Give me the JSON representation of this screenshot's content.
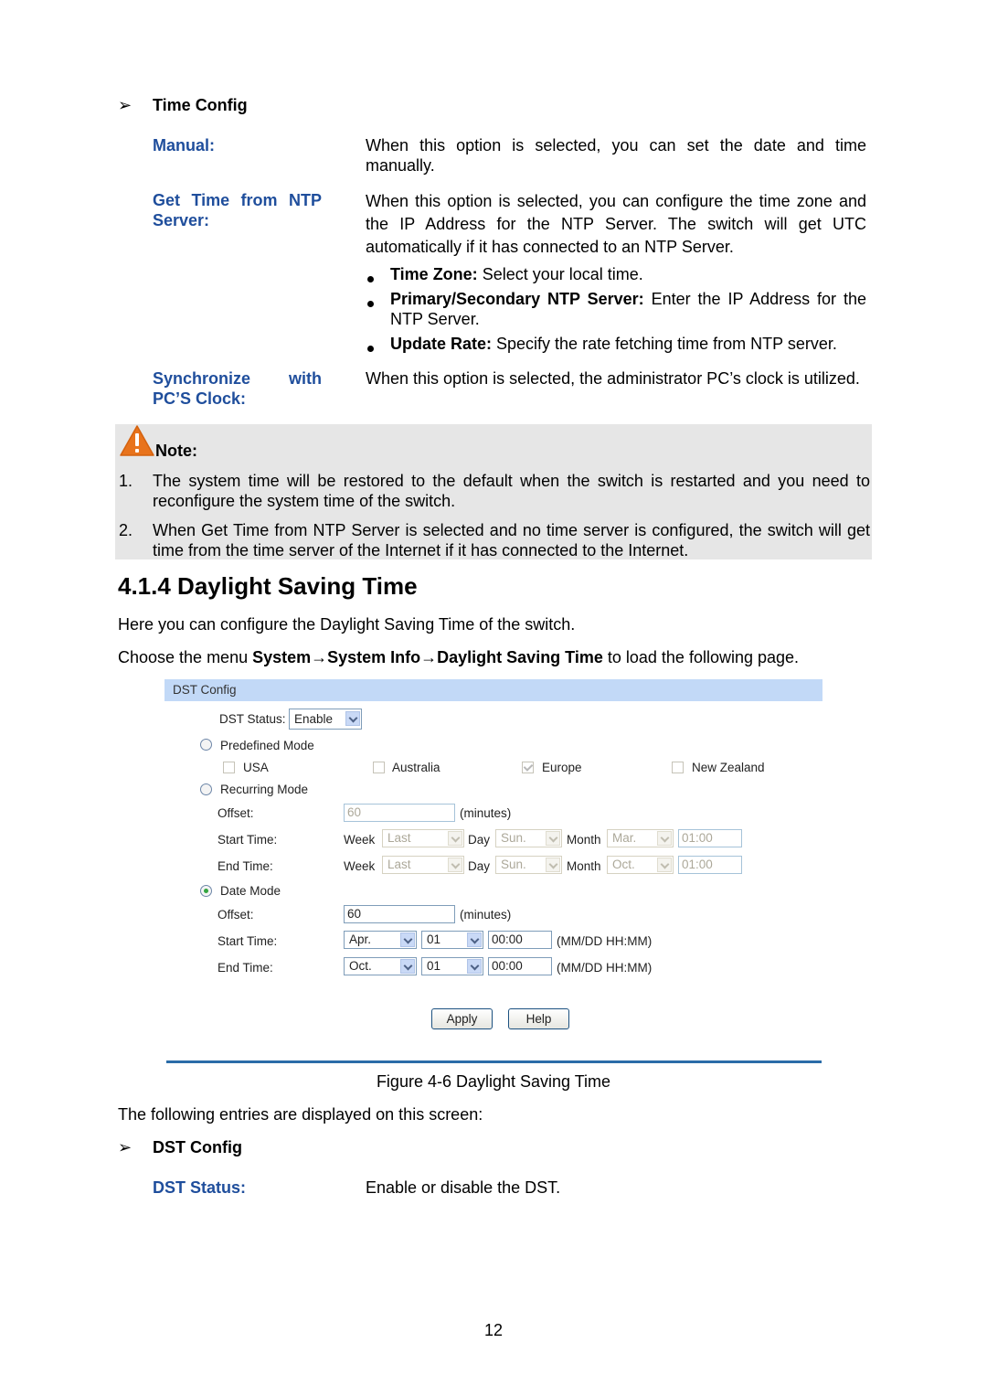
{
  "time_config": {
    "heading": "Time Config",
    "entries": [
      {
        "term": "Manual:",
        "desc": "When this option is selected, you can set the date and time manually."
      },
      {
        "term_line1": "Get Time from NTP",
        "term_line2": "Server:",
        "desc": "When this option is selected, you can configure the time zone and the IP Address for the NTP Server. The switch will get UTC automatically if it has connected to an NTP Server."
      },
      {
        "term_line1": "Synchronize with",
        "term_line2": "PC’S Clock:",
        "desc": "When this option is selected, the administrator PC’s clock is utilized."
      }
    ],
    "bullets": [
      {
        "bold": "Time Zone:",
        "text": " Select your local time."
      },
      {
        "bold": "Primary/Secondary NTP Server:",
        "text": " Enter the IP Address for the NTP Server."
      },
      {
        "bold": "Update Rate:",
        "text": " Specify the rate fetching time from NTP server."
      }
    ]
  },
  "note": {
    "label": "Note:",
    "items": [
      {
        "num": "1.",
        "text": "The system time will be restored to the default when the switch is restarted and you need to reconfigure the system time of the switch."
      },
      {
        "num": "2.",
        "text": "When Get Time from NTP Server is selected and no time server is configured, the switch will get time from the time server of the Internet if it has connected to the Internet."
      }
    ]
  },
  "section": {
    "title": "4.1.4 Daylight Saving Time",
    "intro": "Here you can configure the Daylight Saving Time of the switch.",
    "menu_prefix": "Choose the menu ",
    "menu_path": "System→System Info→Daylight Saving Time",
    "menu_suffix": " to load the following page."
  },
  "dst_ui": {
    "header": "DST Config",
    "status_label": "DST Status:",
    "status_value": "Enable",
    "predefined": {
      "label": "Predefined Mode",
      "selected": false,
      "options": [
        {
          "label": "USA",
          "checked": false
        },
        {
          "label": "Australia",
          "checked": false
        },
        {
          "label": "Europe",
          "checked": true
        },
        {
          "label": "New Zealand",
          "checked": false
        }
      ]
    },
    "recurring": {
      "label": "Recurring Mode",
      "selected": false,
      "offset_label": "Offset:",
      "offset_value": "60",
      "offset_unit": "(minutes)",
      "start_label": "Start Time:",
      "end_label": "End Time:",
      "week_label": "Week",
      "day_label": "Day",
      "month_label": "Month",
      "start": {
        "week": "Last",
        "day": "Sun.",
        "month": "Mar.",
        "time": "01:00"
      },
      "end": {
        "week": "Last",
        "day": "Sun.",
        "month": "Oct.",
        "time": "01:00"
      }
    },
    "date_mode": {
      "label": "Date Mode",
      "selected": true,
      "offset_label": "Offset:",
      "offset_value": "60",
      "offset_unit": "(minutes)",
      "start_label": "Start Time:",
      "end_label": "End Time:",
      "format_hint": "(MM/DD HH:MM)",
      "start": {
        "month": "Apr.",
        "day": "01",
        "time": "00:00"
      },
      "end": {
        "month": "Oct.",
        "day": "01",
        "time": "00:00"
      }
    },
    "apply_label": "Apply",
    "help_label": "Help"
  },
  "figure_caption": "Figure 4-6 Daylight Saving Time",
  "entries_intro": "The following entries are displayed on this screen:",
  "dst_config": {
    "heading": "DST Config",
    "entries": [
      {
        "term": "DST Status:",
        "desc": "Enable or disable the DST."
      }
    ]
  },
  "page_number": "12"
}
